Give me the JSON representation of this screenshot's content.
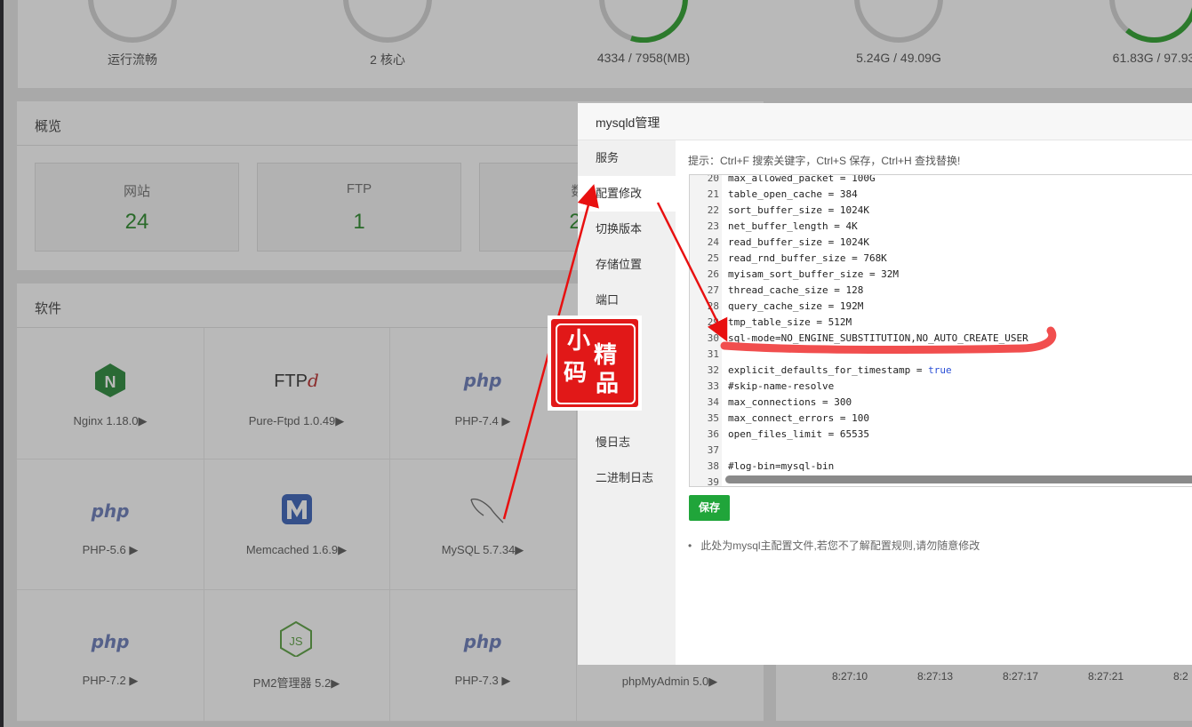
{
  "gauges": [
    {
      "label": "运行流畅"
    },
    {
      "label": "2 核心"
    },
    {
      "label": "4334 / 7958(MB)"
    },
    {
      "label": "5.24G / 49.09G"
    },
    {
      "label": "61.83G / 97.93"
    }
  ],
  "overview": {
    "title": "概览",
    "stats": [
      {
        "label": "网站",
        "value": "24"
      },
      {
        "label": "FTP",
        "value": "1"
      },
      {
        "label": "数",
        "value": "2"
      }
    ]
  },
  "software": {
    "title": "软件",
    "items": [
      {
        "icon": "nginx-icon",
        "label": "Nginx 1.18.0▶"
      },
      {
        "icon": "ftp-icon",
        "label": "Pure-Ftpd 1.0.49▶",
        "icon_text": "FTP",
        "icon_text_em": "d"
      },
      {
        "icon": "php-icon",
        "label": "PHP-7.4 ▶",
        "icon_text": "php"
      },
      {
        "icon": "php-icon",
        "label": "PHP-5.6 ▶",
        "icon_text": "php"
      },
      {
        "icon": "memcached-icon",
        "label": "Memcached 1.6.9▶"
      },
      {
        "icon": "mysql-icon",
        "label": "MySQL 5.7.34▶"
      },
      {
        "icon": "php-icon",
        "label": "PHP-7.2 ▶",
        "icon_text": "php"
      },
      {
        "icon": "nodejs-icon",
        "label": "PM2管理器 5.2▶"
      },
      {
        "icon": "php-icon",
        "label": "PHP-7.3 ▶",
        "icon_text": "php"
      },
      {
        "icon": "phpmyadmin-icon",
        "label": "phpMyAdmin 5.0▶"
      }
    ]
  },
  "chart_times": [
    "8:27:10",
    "8:27:13",
    "8:27:17",
    "8:27:21",
    "8:2"
  ],
  "modal": {
    "title": "mysqld管理",
    "menu": [
      "服务",
      "配置修改",
      "切换版本",
      "存储位置",
      "端口",
      "",
      "慢日志",
      "二进制日志"
    ],
    "active_index": 1,
    "hint": "提示：Ctrl+F 搜索关键字，Ctrl+S 保存，Ctrl+H 查找替换!",
    "lines": [
      {
        "n": "20",
        "code": "max_allowed_packet = 100G"
      },
      {
        "n": "21",
        "code": "table_open_cache = 384"
      },
      {
        "n": "22",
        "code": "sort_buffer_size = 1024K"
      },
      {
        "n": "23",
        "code": "net_buffer_length = 4K"
      },
      {
        "n": "24",
        "code": "read_buffer_size = 1024K"
      },
      {
        "n": "25",
        "code": "read_rnd_buffer_size = 768K"
      },
      {
        "n": "26",
        "code": "myisam_sort_buffer_size = 32M"
      },
      {
        "n": "27",
        "code": "thread_cache_size = 128"
      },
      {
        "n": "28",
        "code": "query_cache_size = 192M"
      },
      {
        "n": "29",
        "code": "tmp_table_size = 512M"
      },
      {
        "n": "30",
        "code": "sql-mode=NO_ENGINE_SUBSTITUTION,NO_AUTO_CREATE_USER"
      },
      {
        "n": "31",
        "code": ""
      },
      {
        "n": "32",
        "code": "explicit_defaults_for_timestamp = ",
        "kw": "true"
      },
      {
        "n": "33",
        "code": "#skip-name-resolve"
      },
      {
        "n": "34",
        "code": "max_connections = 300"
      },
      {
        "n": "35",
        "code": "max_connect_errors = 100"
      },
      {
        "n": "36",
        "code": "open_files_limit = 65535"
      },
      {
        "n": "37",
        "code": ""
      },
      {
        "n": "38",
        "code": "#log-bin=mysql-bin"
      },
      {
        "n": "39",
        "code": ""
      }
    ],
    "save_label": "保存",
    "note": "此处为mysql主配置文件,若您不了解配置规则,请勿随意修改"
  },
  "stamp": {
    "text": "小码精品"
  },
  "colors": {
    "accent": "#20a53a",
    "annotation": "#e81010",
    "stamp": "#e11818"
  }
}
